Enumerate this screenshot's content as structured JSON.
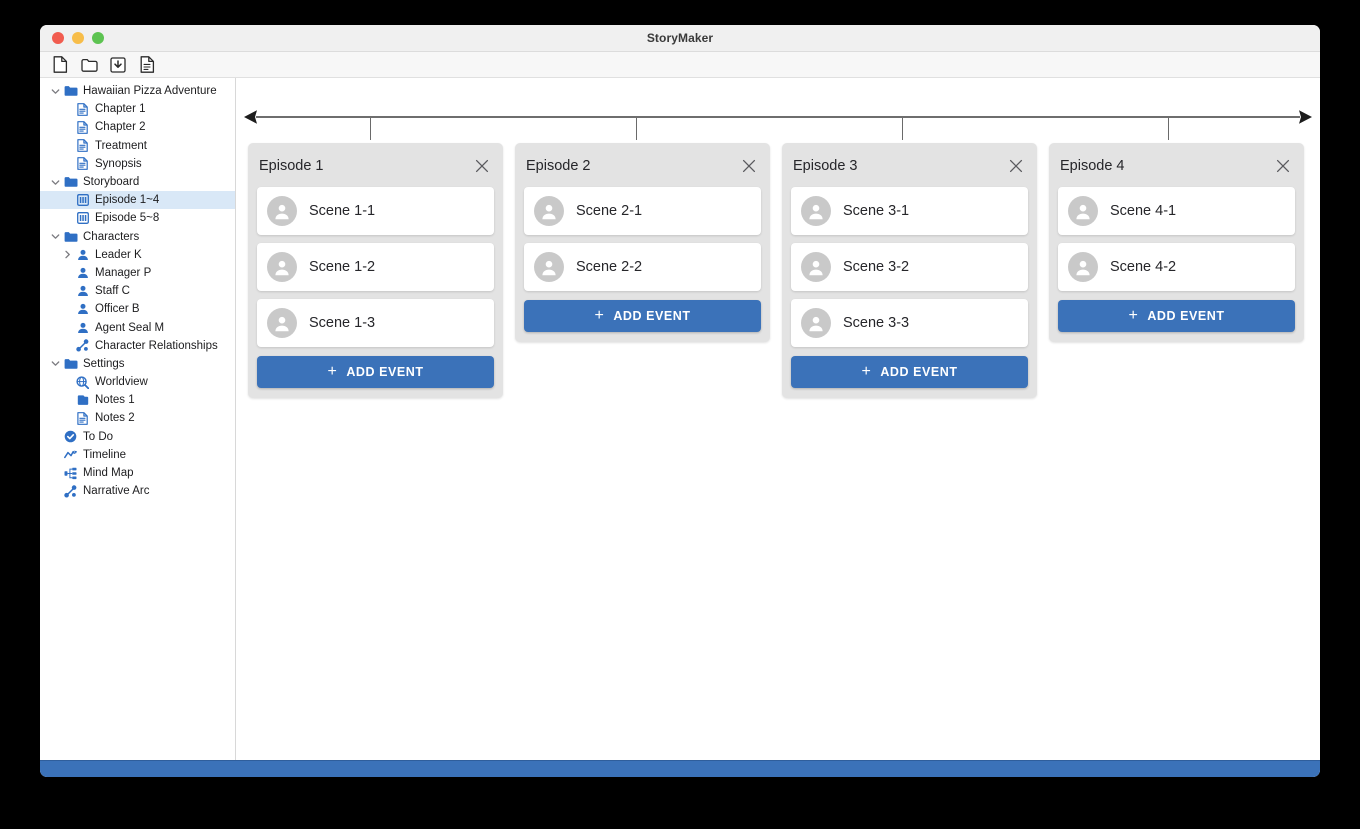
{
  "window": {
    "title": "StoryMaker",
    "traffic_lights": [
      "close",
      "minimize",
      "zoom"
    ]
  },
  "toolbar": {
    "buttons": [
      {
        "name": "new-file-icon",
        "tooltip": "New"
      },
      {
        "name": "open-folder-icon",
        "tooltip": "Open"
      },
      {
        "name": "save-icon",
        "tooltip": "Save"
      },
      {
        "name": "document-icon",
        "tooltip": "Export"
      }
    ]
  },
  "sidebar": {
    "items": [
      {
        "label": "Hawaiian Pizza Adventure",
        "icon": "folder-icon",
        "indent": 0,
        "twisty": "down",
        "selected": false
      },
      {
        "label": "Chapter 1",
        "icon": "doc-icon",
        "indent": 1,
        "twisty": "none",
        "selected": false
      },
      {
        "label": "Chapter 2",
        "icon": "doc-icon",
        "indent": 1,
        "twisty": "none",
        "selected": false
      },
      {
        "label": "Treatment",
        "icon": "doc-icon",
        "indent": 1,
        "twisty": "none",
        "selected": false
      },
      {
        "label": "Synopsis",
        "icon": "doc-icon",
        "indent": 1,
        "twisty": "none",
        "selected": false
      },
      {
        "label": "Storyboard",
        "icon": "folder-icon",
        "indent": 0,
        "twisty": "down",
        "selected": false
      },
      {
        "label": "Episode 1~4",
        "icon": "storyboard-icon",
        "indent": 1,
        "twisty": "none",
        "selected": true
      },
      {
        "label": "Episode 5~8",
        "icon": "storyboard-icon",
        "indent": 1,
        "twisty": "none",
        "selected": false
      },
      {
        "label": "Characters",
        "icon": "folder-icon",
        "indent": 0,
        "twisty": "down",
        "selected": false
      },
      {
        "label": "Leader K",
        "icon": "person-icon",
        "indent": 1,
        "twisty": "right",
        "selected": false
      },
      {
        "label": "Manager P",
        "icon": "person-icon",
        "indent": 1,
        "twisty": "none",
        "selected": false
      },
      {
        "label": "Staff C",
        "icon": "person-icon",
        "indent": 1,
        "twisty": "none",
        "selected": false
      },
      {
        "label": "Officer B",
        "icon": "person-icon",
        "indent": 1,
        "twisty": "none",
        "selected": false
      },
      {
        "label": "Agent Seal M",
        "icon": "person-icon",
        "indent": 1,
        "twisty": "none",
        "selected": false
      },
      {
        "label": "Character Relationships",
        "icon": "relationship-icon",
        "indent": 1,
        "twisty": "none",
        "selected": false
      },
      {
        "label": "Settings",
        "icon": "folder-icon",
        "indent": 0,
        "twisty": "down",
        "selected": false
      },
      {
        "label": "Worldview",
        "icon": "worldview-icon",
        "indent": 1,
        "twisty": "none",
        "selected": false
      },
      {
        "label": "Notes 1",
        "icon": "note-filled-icon",
        "indent": 1,
        "twisty": "none",
        "selected": false
      },
      {
        "label": "Notes 2",
        "icon": "doc-icon",
        "indent": 1,
        "twisty": "none",
        "selected": false
      },
      {
        "label": "To Do",
        "icon": "check-circle-icon",
        "indent": 0,
        "twisty": "none",
        "selected": false
      },
      {
        "label": "Timeline",
        "icon": "timeline-icon",
        "indent": 0,
        "twisty": "none",
        "selected": false
      },
      {
        "label": "Mind Map",
        "icon": "mindmap-icon",
        "indent": 0,
        "twisty": "none",
        "selected": false
      },
      {
        "label": "Narrative Arc",
        "icon": "relationship-icon",
        "indent": 0,
        "twisty": "none",
        "selected": false
      }
    ]
  },
  "main": {
    "axis": {
      "name": "timeline-axis",
      "left_arrow": "◀",
      "right_arrow": "▶",
      "tick_count": 4
    },
    "episodes": [
      {
        "title": "Episode 1",
        "close_label": "×",
        "add_event_label": "ADD EVENT",
        "scenes": [
          "Scene 1-1",
          "Scene 1-2",
          "Scene 1-3"
        ]
      },
      {
        "title": "Episode 2",
        "close_label": "×",
        "add_event_label": "ADD EVENT",
        "scenes": [
          "Scene 2-1",
          "Scene 2-2"
        ]
      },
      {
        "title": "Episode 3",
        "close_label": "×",
        "add_event_label": "ADD EVENT",
        "scenes": [
          "Scene 3-1",
          "Scene 3-2",
          "Scene 3-3"
        ]
      },
      {
        "title": "Episode 4",
        "close_label": "×",
        "add_event_label": "ADD EVENT",
        "scenes": [
          "Scene 4-1",
          "Scene 4-2"
        ]
      }
    ]
  },
  "statusbar": {
    "text": ""
  },
  "colors": {
    "accent_blue": "#3b72b9",
    "card_gray": "#e3e3e3",
    "selection_blue": "#d9e8f7",
    "avatar_gray": "#c9c9c9",
    "icon_blue": "#2f6fc4"
  }
}
